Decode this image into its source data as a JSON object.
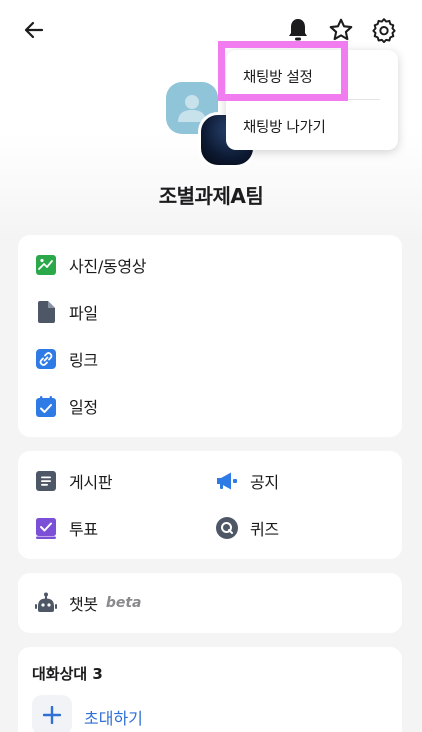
{
  "group": {
    "name": "조별과제A팀"
  },
  "media_section": {
    "items": [
      {
        "label": "사진/동영상",
        "icon": "photo-icon"
      },
      {
        "label": "파일",
        "icon": "file-icon"
      },
      {
        "label": "링크",
        "icon": "link-icon"
      },
      {
        "label": "일정",
        "icon": "calendar-icon"
      }
    ]
  },
  "board_section": {
    "items": [
      {
        "label": "게시판",
        "icon": "board-icon"
      },
      {
        "label": "공지",
        "icon": "megaphone-icon"
      },
      {
        "label": "투표",
        "icon": "vote-icon"
      },
      {
        "label": "퀴즈",
        "icon": "quiz-icon"
      }
    ]
  },
  "chatbot": {
    "label": "챗봇",
    "badge": "beta"
  },
  "members": {
    "title": "대화상대 3",
    "invite_label": "초대하기"
  },
  "menu": {
    "items": [
      {
        "label": "채팅방 설정"
      },
      {
        "label": "채팅방 나가기"
      }
    ]
  },
  "colors": {
    "accent_blue": "#2f6fd6",
    "highlight": "#f07cf0",
    "photo_green": "#2aa84a",
    "vote_purple": "#7b4fd6"
  }
}
